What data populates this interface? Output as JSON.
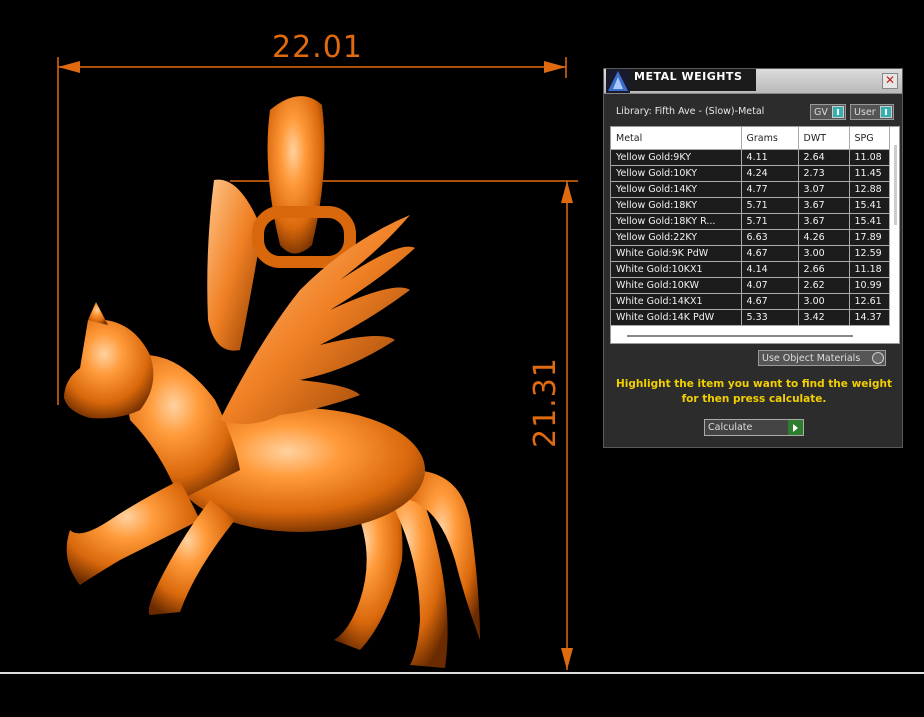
{
  "viewport": {
    "dimension_width": "22.01",
    "dimension_height": "21.31",
    "accent_color": "#e06a10"
  },
  "panel": {
    "title": "METAL WEIGHTS",
    "close_icon": "close-icon",
    "library": "Library: Fifth Ave - (Slow)-Metal",
    "gv_label": "GV",
    "user_label": "User",
    "table": {
      "headers": [
        "Metal",
        "Grams",
        "DWT",
        "SPG"
      ],
      "rows": [
        [
          "Yellow Gold:9KY",
          "4.11",
          "2.64",
          "11.08"
        ],
        [
          "Yellow Gold:10KY",
          "4.24",
          "2.73",
          "11.45"
        ],
        [
          "Yellow Gold:14KY",
          "4.77",
          "3.07",
          "12.88"
        ],
        [
          "Yellow Gold:18KY",
          "5.71",
          "3.67",
          "15.41"
        ],
        [
          "Yellow Gold:18KY R...",
          "5.71",
          "3.67",
          "15.41"
        ],
        [
          "Yellow Gold:22KY",
          "6.63",
          "4.26",
          "17.89"
        ],
        [
          "White Gold:9K PdW",
          "4.67",
          "3.00",
          "12.59"
        ],
        [
          "White Gold:10KX1",
          "4.14",
          "2.66",
          "11.18"
        ],
        [
          "White Gold:10KW",
          "4.07",
          "2.62",
          "10.99"
        ],
        [
          "White Gold:14KX1",
          "4.67",
          "3.00",
          "12.61"
        ],
        [
          "White Gold:14K PdW",
          "5.33",
          "3.42",
          "14.37"
        ]
      ]
    },
    "use_object_materials": "Use Object Materials",
    "instructions": "Highlight the item you want to find the weight for then press calculate.",
    "calculate_label": "Calculate",
    "instruction_color": "#f2d000"
  }
}
